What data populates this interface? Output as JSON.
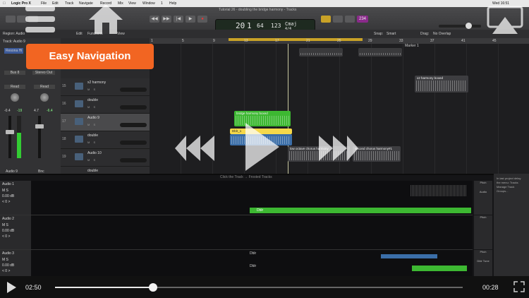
{
  "menubar": {
    "app": "Logic Pro X",
    "items": [
      "File",
      "Edit",
      "Track",
      "Navigate",
      "Record",
      "Mix",
      "View",
      "Window",
      "1",
      "Help"
    ],
    "clock": "Wed 16:51"
  },
  "window_title": "Tutorial 26 - doubling the bridge harmony - Tracks",
  "lcd": {
    "bar": "20",
    "beat": "1",
    "bpm": "64",
    "tempo": "123",
    "key": "Cmaj",
    "sig": "4/4",
    "bar_label": "BAR",
    "beat_label": "BEAT",
    "tempo_label": "TEMPO",
    "keep_label": "KEEP"
  },
  "lcd_badge": "234",
  "controlbar": {
    "region": "Region: Audio",
    "track": "Track: Audio 9",
    "edit": "Edit",
    "functions": "Functions",
    "view": "View",
    "snap_label": "Snap:",
    "snap": "Smart",
    "drag_label": "Drag:",
    "drag": "No Overlap",
    "marker": "Marker 1"
  },
  "ruler_marks": [
    "1",
    "5",
    "9",
    "13",
    "17",
    "21",
    "25",
    "29",
    "33",
    "37",
    "41",
    "45"
  ],
  "inspector": {
    "region_btn": "Resona Hi",
    "left_strip": {
      "insert": "Bus 8",
      "mode": "Read",
      "db1": "-0.4",
      "db2": "-19",
      "name": "Audio 9"
    },
    "right_strip": {
      "insert": "Stereo Out",
      "mode": "Read",
      "db1": "4.7",
      "db2": "-6.4",
      "name": "Bnc"
    }
  },
  "tracks": [
    {
      "num": "14",
      "name": "",
      "selected": false
    },
    {
      "num": "15",
      "name": "x2 harmony",
      "selected": false
    },
    {
      "num": "16",
      "name": "double",
      "selected": false
    },
    {
      "num": "17",
      "name": "Audio 9",
      "selected": true
    },
    {
      "num": "18",
      "name": "double",
      "selected": false
    },
    {
      "num": "19",
      "name": "Audio 10",
      "selected": false
    },
    {
      "num": "",
      "name": "double",
      "selected": false
    }
  ],
  "regions": {
    "harmony_top": "",
    "x2_harmony": "x2 harmony boxed",
    "bridge_harmony": "bridge harmony boxed",
    "dblr": "Dblr_1",
    "low_octave": "low octave chorus harmony",
    "second_chorus": "second chorus harmony#1"
  },
  "editor": {
    "caption": "Click the Track → Frosted Tracks",
    "lanes": [
      {
        "name": "Audio 1",
        "db": "0.00 dB",
        "pan": "< 0 >"
      },
      {
        "name": "Audio 2",
        "db": "0.00 dB",
        "pan": "< 0 >"
      },
      {
        "name": "Audio 3",
        "db": "0.00 dB",
        "pan": "< 0 >"
      }
    ],
    "green_region": "Dblr",
    "lane3_labels": [
      "Dblr",
      "Dblr"
    ],
    "pitch_labels": [
      "Pitch",
      "Pitch",
      "Pitch"
    ],
    "pitch_sub": [
      "Audio",
      "",
      "Dblr Tune"
    ]
  },
  "sidepanel": [
    "In last project delay",
    "the menu: Tracks",
    "Manage Track",
    "Groups..."
  ],
  "banner": "Easy Navigation",
  "player": {
    "current": "02:50",
    "end": "00:28",
    "progress": 0.24
  },
  "colors": {
    "accent": "#f26522",
    "region_green": "#3db832",
    "region_blue": "#3b6ea8",
    "region_yellow": "#f5d84a"
  }
}
